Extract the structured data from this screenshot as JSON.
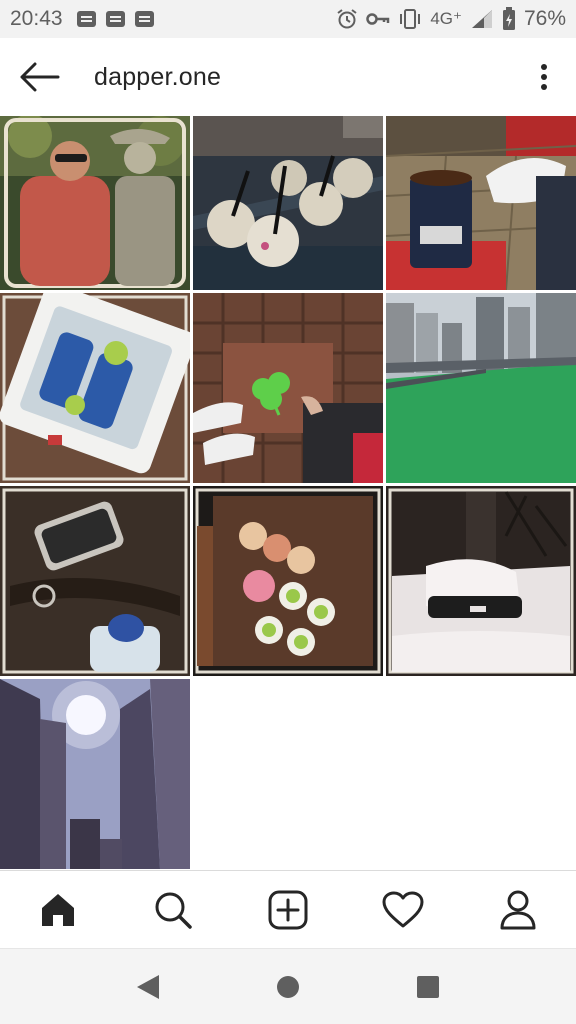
{
  "status_bar": {
    "time": "20:43",
    "network": "4G⁺",
    "battery_pct": "76%",
    "notification_icons": [
      "message-icon",
      "news-icon",
      "news-icon"
    ],
    "system_icons": [
      "alarm-icon",
      "vpn-key-icon",
      "vibrate-icon",
      "signal-icon",
      "battery-icon"
    ]
  },
  "header": {
    "title": "dapper.one",
    "back_icon": "arrow-left-icon",
    "menu_icon": "more-vertical-icon"
  },
  "grid": {
    "photos": [
      {
        "subject": "couple-with-statue"
      },
      {
        "subject": "drinks-on-table"
      },
      {
        "subject": "beer-koozie-patio"
      },
      {
        "subject": "beer-cooler"
      },
      {
        "subject": "shamrock-sidewalk"
      },
      {
        "subject": "green-river-city"
      },
      {
        "subject": "keytag-bag"
      },
      {
        "subject": "sushi-platter"
      },
      {
        "subject": "snow-covered-car"
      },
      {
        "subject": "skyscrapers-sun"
      }
    ]
  },
  "bottom_nav": {
    "items": [
      {
        "name": "home",
        "icon": "home-icon",
        "active": true
      },
      {
        "name": "search",
        "icon": "search-icon",
        "active": false
      },
      {
        "name": "new-post",
        "icon": "add-post-icon",
        "active": false
      },
      {
        "name": "activity",
        "icon": "heart-icon",
        "active": false
      },
      {
        "name": "profile",
        "icon": "profile-icon",
        "active": false
      }
    ]
  },
  "system_nav": {
    "items": [
      "back-triangle-icon",
      "home-circle-icon",
      "recents-square-icon"
    ]
  },
  "colors": {
    "text_primary": "#262626",
    "status_text": "#5f5f5f",
    "status_bg": "#f2f2f2",
    "divider": "#dbdbdb"
  }
}
